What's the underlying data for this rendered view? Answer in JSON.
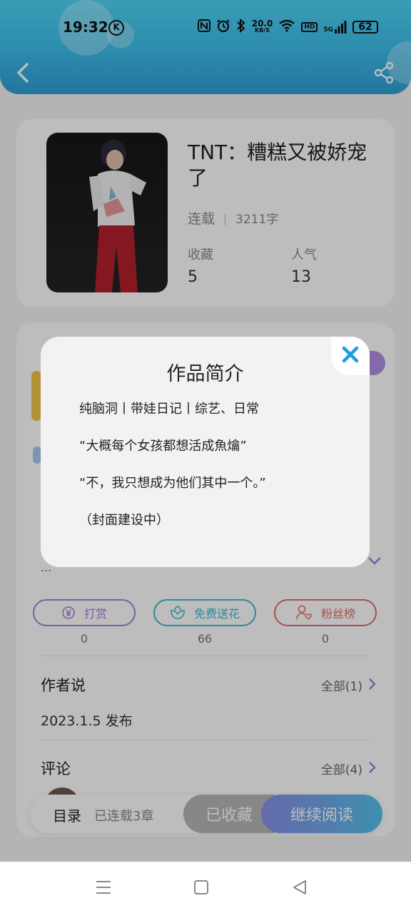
{
  "status_bar": {
    "time": "19:32",
    "k_icon": "K",
    "net_speed_value": "20.0",
    "net_speed_unit": "KB/S",
    "hd_label": "HD",
    "network_label": "5G",
    "battery": "62"
  },
  "book": {
    "title": "TNT：糟糕又被娇宠了",
    "status": "连载",
    "words": "3211字",
    "stats": [
      {
        "label": "收藏",
        "value": "5"
      },
      {
        "label": "人气",
        "value": "13"
      }
    ]
  },
  "background_section": {
    "ellipsis": "..."
  },
  "actions": [
    {
      "label": "打赏",
      "count": "0",
      "color": "#a77fd9",
      "icon": "yen-coin-icon"
    },
    {
      "label": "免费送花",
      "count": "66",
      "color": "#3bbbd0",
      "icon": "flower-icon"
    },
    {
      "label": "粉丝榜",
      "count": "0",
      "color": "#e96a6a",
      "icon": "fan-person-heart-icon"
    }
  ],
  "author_says": {
    "title": "作者说",
    "link": "全部(1)",
    "content": "2023.1.5  发布"
  },
  "comments": {
    "title": "评论",
    "link": "全部(4)"
  },
  "bottom_bar": {
    "catalog_label": "目录",
    "chapters": "已连载3章",
    "collected_label": "已收藏",
    "read_label": "继续阅读"
  },
  "modal": {
    "title": "作品简介",
    "lines": [
      "纯脑洞丨带娃日记丨综艺、日常",
      "“大概每个女孩都想活成魚爚”",
      "“不，我只想成为他们其中一个。”",
      "（封面建设中）"
    ]
  },
  "colors": {
    "header_top": "#4fd4f5",
    "header_bottom": "#2f9fd6",
    "accent_blue": "#1e9be0",
    "read_gradient_start": "#8a8fe8",
    "read_gradient_end": "#55c0ec"
  }
}
